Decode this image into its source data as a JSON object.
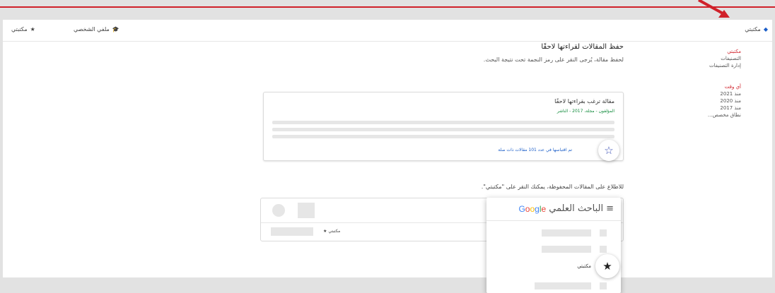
{
  "topbar": {
    "my_library_label": "مكتبتي",
    "my_profile_label": "ملفي الشخصي",
    "my_library_right_label": "مكتبتي"
  },
  "sidebar": {
    "my_library": "مكتبتي",
    "labels": "التصنيفات",
    "manage_labels": "إدارة التصنيفات",
    "any_time": "أي وقت",
    "year_2021": "منذ 2021",
    "year_2020": "منذ 2020",
    "year_2017": "منذ 2017",
    "custom_range": "نطاق مخصص..."
  },
  "main": {
    "heading": "حفظ المقالات لقراءتها لاحقًا",
    "instruction": "لحفظ مقالة، يُرجى النقر على رمز النجمة تحت نتيجة البحث.",
    "view_instruction": "للاطلاع على المقالات المحفوظة، يمكنك النقر على \"مكتبتي\"."
  },
  "card": {
    "title": "مقالة ترغب بقراءتها لاحقًا",
    "meta": "المؤلفون - مجلة، 2017 - الناشر",
    "links": "تم اقتباسها في عدد 101 مقالات ذات صلة"
  },
  "demo": {
    "library_label": "مكتبتي",
    "popup_title": "الباحث العلمي",
    "google_letters": [
      "G",
      "o",
      "o",
      "g",
      "l",
      "e"
    ],
    "popup_library": "مكتبتي"
  },
  "colors": {
    "accent_red": "#d0212a",
    "link_blue": "#1a5dc8",
    "meta_green": "#0f8a3a",
    "google": [
      "#4285f4",
      "#ea4335",
      "#fbbc05",
      "#4285f4",
      "#34a853",
      "#ea4335"
    ]
  },
  "icons": {
    "scholar_cap": "graduation-cap-icon",
    "star": "star-icon",
    "star_outline": "star-outline-icon",
    "menu": "menu-icon",
    "arrow": "red-arrow-icon"
  }
}
